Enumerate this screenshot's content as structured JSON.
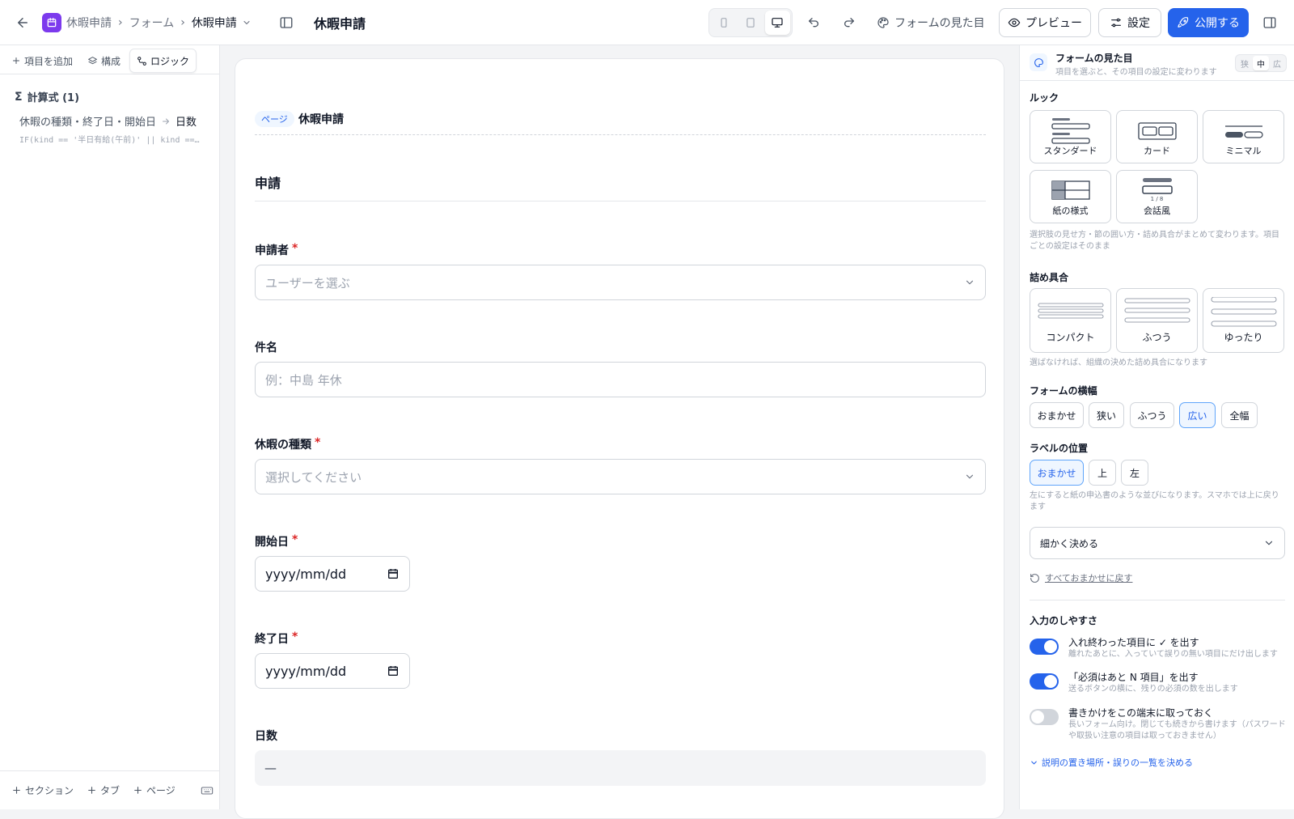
{
  "header": {
    "app_name": "休暇申請",
    "crumb_forms": "フォーム",
    "crumb_current": "休暇申請",
    "title": "休暇申請",
    "appearance_label": "フォームの見た目",
    "preview_label": "プレビュー",
    "settings_label": "設定",
    "publish_label": "公開する",
    "accent_color": "#2563eb"
  },
  "left_panel": {
    "tabs": [
      {
        "label": "項目を追加"
      },
      {
        "label": "構成"
      },
      {
        "label": "ロジック"
      }
    ],
    "formula_header": "計算式 (1)",
    "formula": {
      "inputs": "休暇の種類・終了日・開始日",
      "target": "日数",
      "expression": "IF(kind == '半日有給(午前)' || kind == '半…"
    },
    "bottom": [
      {
        "label": "セクション"
      },
      {
        "label": "タブ"
      },
      {
        "label": "ページ"
      }
    ]
  },
  "canvas": {
    "page_chip": "ページ",
    "page_title": "休暇申請",
    "section_title": "申請",
    "required_mark": "*",
    "fields": {
      "applicant": {
        "label": "申請者",
        "placeholder": "ユーザーを選ぶ"
      },
      "subject": {
        "label": "件名",
        "placeholder": "例：中島 年休"
      },
      "kind": {
        "label": "休暇の種類",
        "placeholder": "選択してください"
      },
      "start": {
        "label": "開始日",
        "value": "yyyy/mm/dd"
      },
      "end": {
        "label": "終了日",
        "value": "yyyy/mm/dd"
      },
      "days": {
        "label": "日数",
        "value": "—"
      }
    }
  },
  "right_panel": {
    "title": "フォームの見た目",
    "subtitle": "項目を選ぶと、その項目の設定に変わります",
    "sizes": [
      "狭",
      "中",
      "広"
    ],
    "look_label": "ルック",
    "looks": [
      "スタンダード",
      "カード",
      "ミニマル",
      "紙の様式",
      "会話風"
    ],
    "chat_counter": "1 / 8",
    "look_note": "選択肢の見せ方・節の囲い方・詰め具合がまとめて変わります。項目ごとの設定はそのまま",
    "density_label": "詰め具合",
    "densities": [
      "コンパクト",
      "ふつう",
      "ゆったり"
    ],
    "density_note": "選ばなければ、組織の決めた詰め具合になります",
    "width_label": "フォームの横幅",
    "widths": [
      "おまかせ",
      "狭い",
      "ふつう",
      "広い",
      "全幅"
    ],
    "label_pos_label": "ラベルの位置",
    "label_positions": [
      "おまかせ",
      "上",
      "左"
    ],
    "label_pos_note": "左にすると紙の申込書のような並びになります。スマホでは上に戻ります",
    "detail_select": "細かく決める",
    "reset_all": "すべておまかせに戻す",
    "usability_label": "入力のしやすさ",
    "toggles": [
      {
        "title": "入れ終わった項目に ✓ を出す",
        "sub": "離れたあとに、入っていて誤りの無い項目にだけ出します",
        "on": true
      },
      {
        "title": "「必須はあと N 項目」を出す",
        "sub": "送るボタンの横に、残りの必須の数を出します",
        "on": true
      },
      {
        "title": "書きかけをこの端末に取っておく",
        "sub": "長いフォーム向け。閉じても続きから書けます（パスワードや取扱い注意の項目は取っておきません）",
        "on": false
      }
    ],
    "more_link": "説明の置き場所・誤りの一覧を決める"
  }
}
